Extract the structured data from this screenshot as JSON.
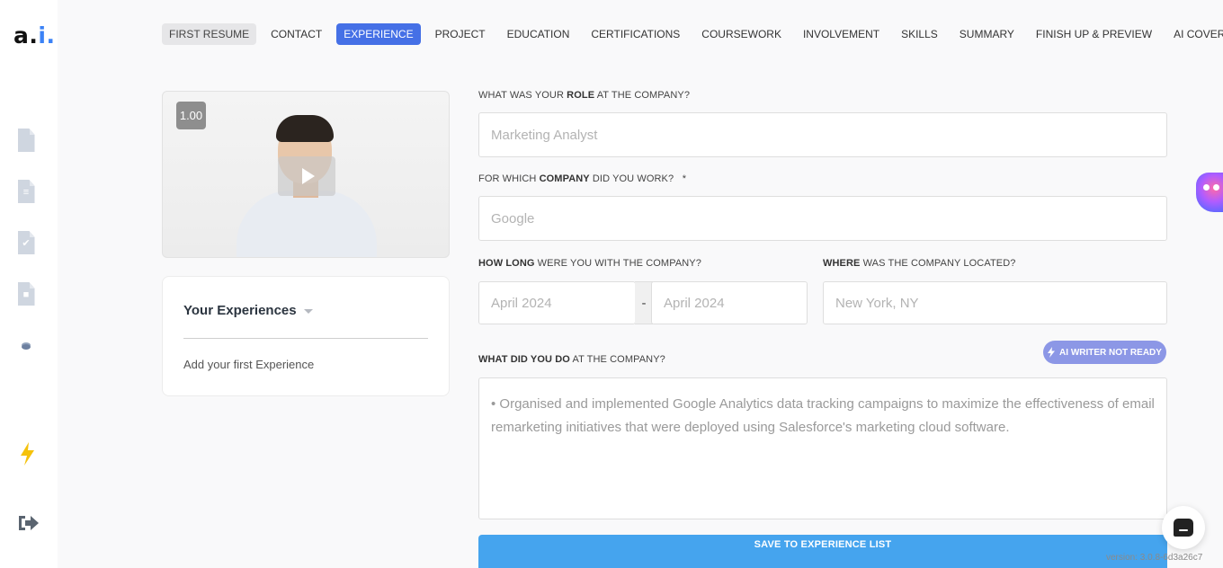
{
  "logo": {
    "part1": "a.",
    "part2": "i",
    "part3": "."
  },
  "nav": {
    "tabs": [
      {
        "label": "FIRST RESUME"
      },
      {
        "label": "CONTACT"
      },
      {
        "label": "EXPERIENCE"
      },
      {
        "label": "PROJECT"
      },
      {
        "label": "EDUCATION"
      },
      {
        "label": "CERTIFICATIONS"
      },
      {
        "label": "COURSEWORK"
      },
      {
        "label": "INVOLVEMENT"
      },
      {
        "label": "SKILLS"
      },
      {
        "label": "SUMMARY"
      },
      {
        "label": "FINISH UP & PREVIEW"
      },
      {
        "label": "AI COVER LETTER"
      }
    ],
    "active_tab": "EXPERIENCE"
  },
  "video": {
    "speed": "1.00"
  },
  "experiences": {
    "title": "Your Experiences",
    "empty_text": "Add your first Experience"
  },
  "form": {
    "role": {
      "label_pre": "WHAT WAS YOUR ",
      "label_bold": "ROLE",
      "label_post": " AT THE COMPANY?",
      "placeholder": "Marketing Analyst"
    },
    "company": {
      "label_pre": "FOR WHICH ",
      "label_bold": "COMPANY",
      "label_post": " DID YOU WORK?",
      "required": "*",
      "placeholder": "Google"
    },
    "duration": {
      "label_bold": "HOW LONG",
      "label_post": " WERE YOU WITH THE COMPANY?",
      "start_placeholder": "April 2024",
      "separator": "-",
      "end_placeholder": "April 2024"
    },
    "location": {
      "label_bold": "WHERE",
      "label_post": " WAS THE COMPANY LOCATED?",
      "placeholder": "New York, NY"
    },
    "description": {
      "label_bold": "WHAT DID YOU DO",
      "label_post": " AT THE COMPANY?",
      "placeholder": "• Organised and implemented Google Analytics data tracking campaigns to maximize the effectiveness of email remarketing initiatives that were deployed using Salesforce's marketing cloud software."
    },
    "ai_writer": {
      "label": "AI WRITER NOT READY"
    },
    "save": {
      "label": "SAVE TO EXPERIENCE LIST"
    }
  },
  "version": "version: 3.0.8-6d3a26c7",
  "colors": {
    "accent": "#4570e6",
    "save": "#45a4ee",
    "ai_pill": "#8c97e6",
    "bolt": "#f5c20b"
  }
}
